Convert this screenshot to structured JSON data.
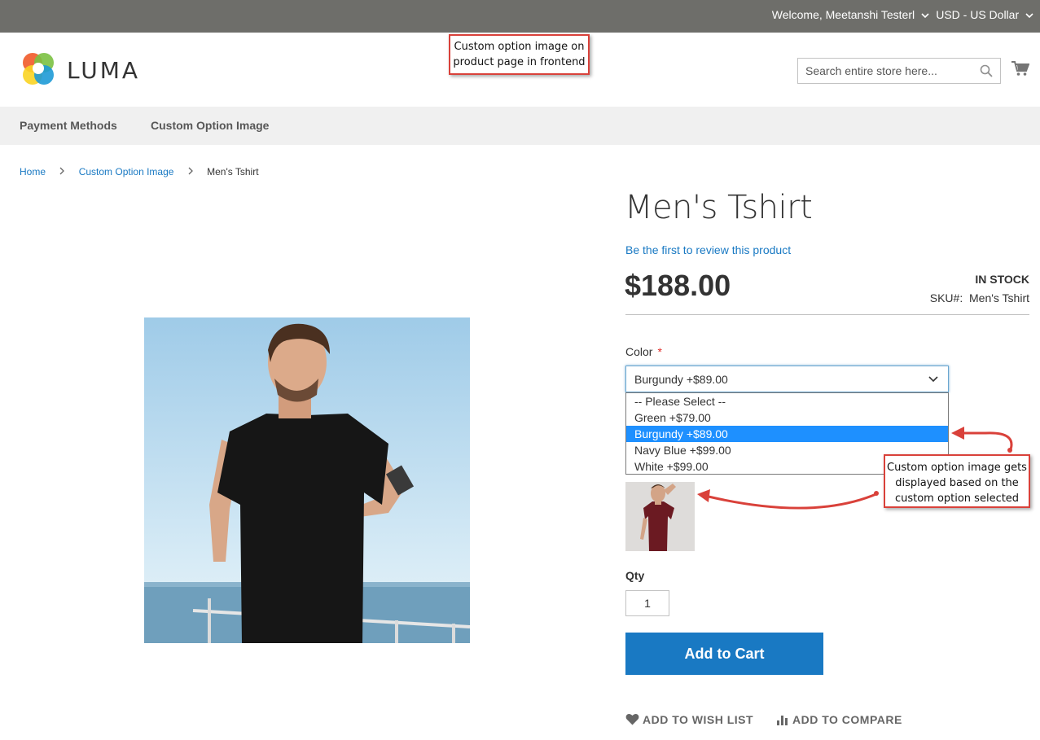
{
  "topbar": {
    "welcome": "Welcome, Meetanshi Testerl",
    "currency": "USD - US Dollar"
  },
  "header": {
    "logo_text": "LUMA",
    "search_placeholder": "Search entire store here..."
  },
  "annotations": {
    "top": [
      "Custom option image on",
      "product page in frontend"
    ],
    "side": [
      "Custom option image gets",
      "displayed based on the",
      "custom option selected"
    ]
  },
  "nav": {
    "items": [
      {
        "label": "Payment Methods"
      },
      {
        "label": "Custom Option Image"
      }
    ]
  },
  "breadcrumb": {
    "home": "Home",
    "category": "Custom Option Image",
    "current": "Men's Tshirt"
  },
  "product": {
    "title": "Men's Tshirt",
    "review_link": "Be the first to review this product",
    "price": "$188.00",
    "stock": "IN STOCK",
    "sku_label": "SKU#:",
    "sku_value": "Men's Tshirt"
  },
  "options": {
    "color_label": "Color",
    "required_mark": "*",
    "selected": "Burgundy +$89.00",
    "list": [
      {
        "label": "-- Please Select --",
        "selected": false
      },
      {
        "label": "Green +$79.00",
        "selected": false
      },
      {
        "label": "Burgundy +$89.00",
        "selected": true
      },
      {
        "label": "Navy Blue +$99.00",
        "selected": false
      },
      {
        "label": "White +$99.00",
        "selected": false
      }
    ]
  },
  "cart": {
    "qty_label": "Qty",
    "qty_value": "1",
    "add_to_cart": "Add to Cart"
  },
  "actions": {
    "wishlist": "ADD TO WISH LIST",
    "compare": "ADD TO COMPARE"
  },
  "colors": {
    "topbar": "#6e6e6a",
    "link": "#1979c3",
    "primary_button": "#1979c3",
    "annotation_border": "#d9413a",
    "dropdown_highlight": "#1e90ff",
    "swatch_shirt": "#6b1a22"
  }
}
